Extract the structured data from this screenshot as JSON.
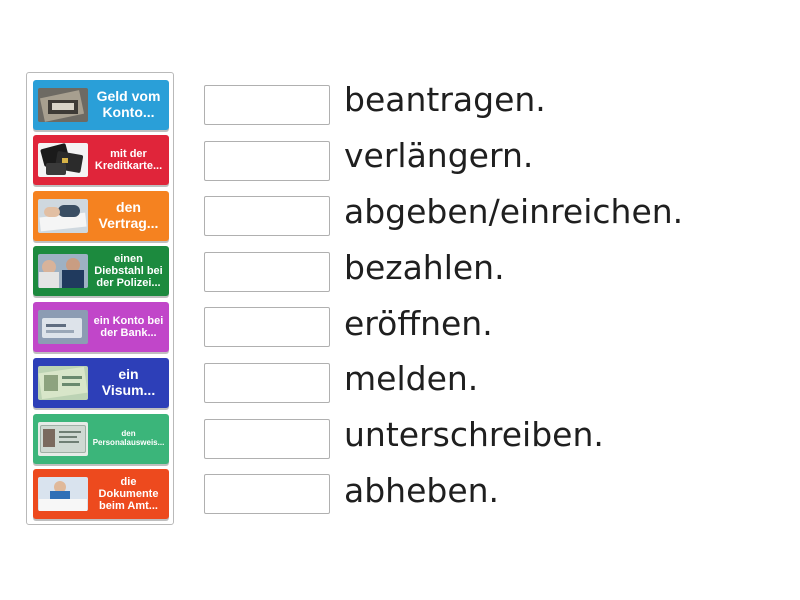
{
  "tiles": [
    {
      "label": "Geld vom Konto...",
      "color": "#2a9fd8",
      "image": "atm-cash-image"
    },
    {
      "label": "mit der Kreditkarte...",
      "color": "#e0253a",
      "image": "credit-cards-image"
    },
    {
      "label": "den Vertrag...",
      "color": "#f58220",
      "image": "contract-signing-image"
    },
    {
      "label": "einen Diebstahl bei der Polizei...",
      "color": "#1c8a3e",
      "image": "police-report-image"
    },
    {
      "label": "ein Konto bei der Bank...",
      "color": "#c146c9",
      "image": "bank-card-image"
    },
    {
      "label": "ein Visum...",
      "color": "#2d3fb8",
      "image": "visa-passport-image"
    },
    {
      "label": "den Personalausweis...",
      "color": "#3bb57a",
      "image": "id-card-image"
    },
    {
      "label": "die Dokumente beim Amt...",
      "color": "#ed4a1e",
      "image": "office-documents-image"
    }
  ],
  "phrases": [
    "beantragen.",
    "verlängern.",
    "abgeben/einreichen.",
    "bezahlen.",
    "eröffnen.",
    "melden.",
    "unterschreiben.",
    "abheben."
  ]
}
